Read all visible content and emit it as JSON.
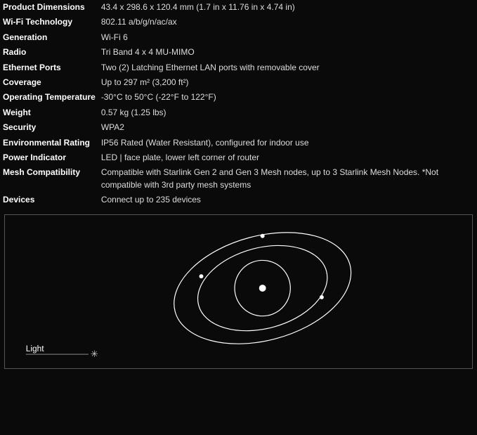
{
  "specs": [
    {
      "label": "Product Dimensions",
      "value": "43.4 x 298.6 x 120.4 mm (1.7 in x 11.76 in x 4.74 in)"
    },
    {
      "label": "Wi-Fi Technology",
      "value": "802.11 a/b/g/n/ac/ax"
    },
    {
      "label": "Generation",
      "value": "Wi-Fi 6"
    },
    {
      "label": "Radio",
      "value": "Tri Band 4 x 4 MU-MIMO"
    },
    {
      "label": "Ethernet Ports",
      "value": "Two (2) Latching Ethernet LAN ports with removable cover"
    },
    {
      "label": "Coverage",
      "value": "Up to 297 m² (3,200 ft²)"
    },
    {
      "label": "Operating Temperature",
      "value": "-30°C to 50°C (-22°F to 122°F)"
    },
    {
      "label": "Weight",
      "value": "0.57 kg (1.25 lbs)"
    },
    {
      "label": "Security",
      "value": "WPA2"
    },
    {
      "label": "Environmental Rating",
      "value": "IP56 Rated (Water Resistant), configured for indoor use"
    },
    {
      "label": "Power Indicator",
      "value": "LED | face plate, lower left corner of router"
    },
    {
      "label": "Mesh Compatibility",
      "value": "Compatible with Starlink Gen 2 and Gen 3 Mesh nodes, up to 3 Starlink Mesh Nodes. *Not compatible with 3rd party mesh systems"
    },
    {
      "label": "Devices",
      "value": "Connect up to 235 devices"
    }
  ],
  "diagram": {
    "light_label": "Light"
  }
}
